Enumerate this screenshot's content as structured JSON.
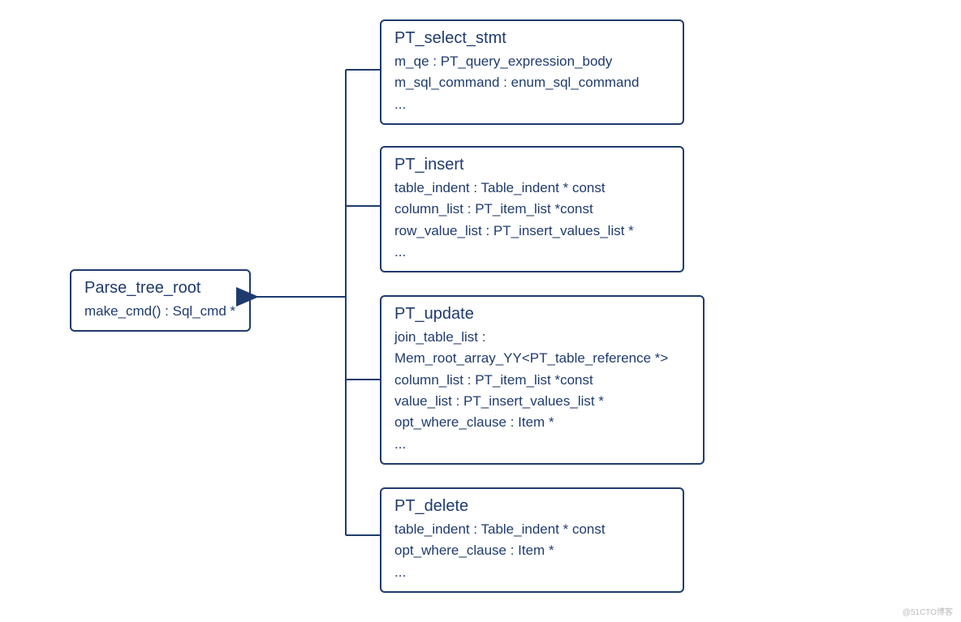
{
  "root": {
    "title": "Parse_tree_root",
    "attrs": [
      "make_cmd() : Sql_cmd *"
    ]
  },
  "children": [
    {
      "title": "PT_select_stmt",
      "attrs": [
        "m_qe : PT_query_expression_body",
        "m_sql_command : enum_sql_command",
        "..."
      ]
    },
    {
      "title": "PT_insert",
      "attrs": [
        "table_indent : Table_indent * const",
        "column_list : PT_item_list *const",
        "row_value_list : PT_insert_values_list *",
        "..."
      ]
    },
    {
      "title": "PT_update",
      "attrs": [
        "join_table_list :",
        "Mem_root_array_YY<PT_table_reference *>",
        "column_list : PT_item_list *const",
        "value_list : PT_insert_values_list *",
        "opt_where_clause : Item *",
        "..."
      ]
    },
    {
      "title": "PT_delete",
      "attrs": [
        "table_indent : Table_indent * const",
        "opt_where_clause : Item *",
        "..."
      ]
    }
  ],
  "watermark": "@51CTO博客"
}
